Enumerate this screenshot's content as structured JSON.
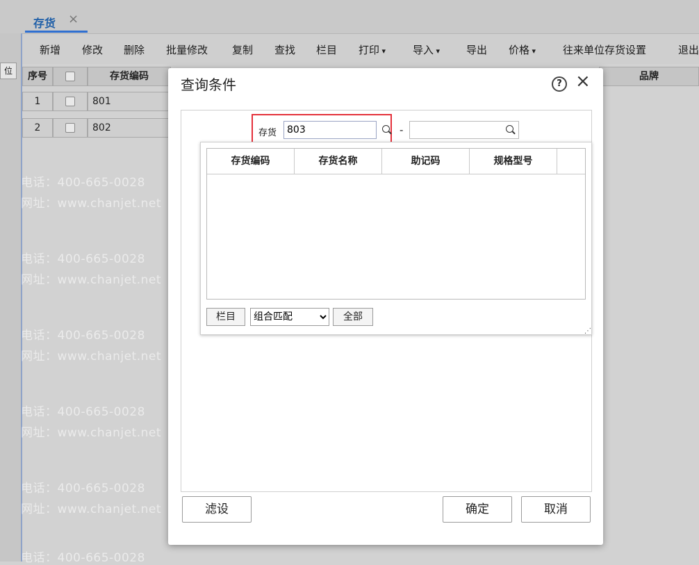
{
  "tab": {
    "label": "存货",
    "close": "×"
  },
  "left_button": "位",
  "toolbar": {
    "items": [
      {
        "label": "新增"
      },
      {
        "label": "修改"
      },
      {
        "label": "删除"
      },
      {
        "label": "批量修改"
      },
      {
        "label": "复制"
      },
      {
        "label": "查找"
      },
      {
        "label": "栏目"
      },
      {
        "label": "打印"
      },
      {
        "label": "导入"
      },
      {
        "label": "导出"
      },
      {
        "label": "价格"
      },
      {
        "label": "往来单位存货设置"
      },
      {
        "label": "退出"
      }
    ]
  },
  "grid": {
    "headers": {
      "seq": "序号",
      "code": "存货编码",
      "brand": "品牌"
    },
    "rows": [
      {
        "seq": "1",
        "code": "801"
      },
      {
        "seq": "2",
        "code": "802"
      }
    ]
  },
  "watermark": {
    "phone": "电话：400-665-0028",
    "site": "网址：www.chanjet.net"
  },
  "dialog": {
    "title": "查询条件",
    "help": "?",
    "close": "×",
    "inventory_label": "存货",
    "inventory_from": "803",
    "dash": "-",
    "inventory_to": "",
    "popup": {
      "columns": [
        "存货编码",
        "存货名称",
        "助记码",
        "规格型号"
      ],
      "column_button": "栏目",
      "match_mode": "组合匹配",
      "all_button": "全部",
      "resize": "⋰"
    },
    "footer": {
      "filter": "滤设",
      "ok": "确定",
      "cancel": "取消"
    }
  }
}
